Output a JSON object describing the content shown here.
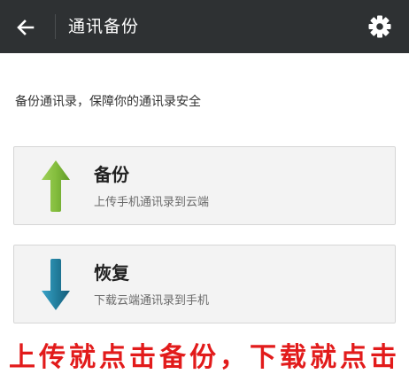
{
  "header": {
    "title": "通讯备份",
    "back_icon": "arrow-left-icon",
    "settings_icon": "gear-icon"
  },
  "description": "备份通讯录，保障你的通讯录安全",
  "actions": [
    {
      "title": "备份",
      "subtitle": "上传手机通讯录到云端",
      "icon": "arrow-up-icon",
      "icon_color": "#7fb539"
    },
    {
      "title": "恢复",
      "subtitle": "下载云端通讯录到手机",
      "icon": "arrow-down-icon",
      "icon_color": "#1d6f94"
    }
  ],
  "caption": "上传就点击备份，下载就点击",
  "colors": {
    "header_bg": "#2e3133",
    "caption": "#e21b1b"
  }
}
